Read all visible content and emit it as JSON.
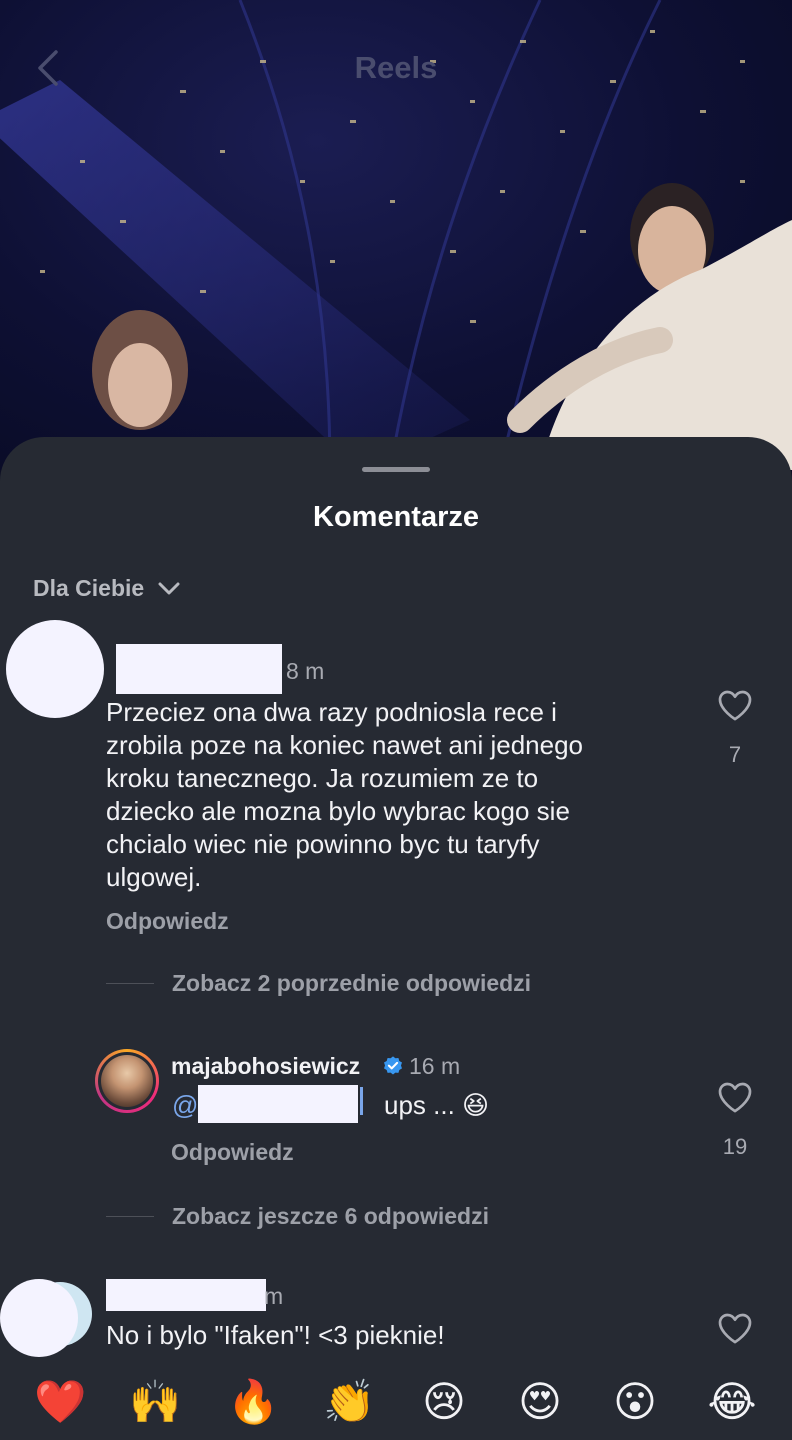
{
  "header": {
    "title": "Reels"
  },
  "sheet": {
    "title": "Komentarze",
    "sort_label": "Dla Ciebie"
  },
  "comments": [
    {
      "time": "8 m",
      "text_lines": [
        "Przeciez ona dwa razy podniosla rece i",
        "zrobila poze na koniec nawet ani jednego",
        "kroku tanecznego. Ja rozumiem ze to",
        "dziecko ale mozna bylo wybrac kogo sie",
        "chcialo wiec nie powinno byc tu taryfy",
        "ulgowej."
      ],
      "reply_label": "Odpowiedz",
      "likes": "7",
      "view_previous": "Zobacz 2 poprzednie odpowiedzi"
    },
    {
      "username": "majabohosiewicz",
      "time": "16 m",
      "mention_prefix": "@",
      "text": "ups ... 😆",
      "reply_label": "Odpowiedz",
      "likes": "19",
      "view_more": "Zobacz jeszcze 6 odpowiedzi"
    },
    {
      "time": "m",
      "text": "No i bylo \"Ifaken\"! <3 pieknie!"
    }
  ],
  "reactions": [
    "❤️",
    "🙌",
    "🔥",
    "👏",
    "😢",
    "😍",
    "😮",
    "😂"
  ],
  "colors": {
    "sheet": "#262a33",
    "verified": "#3897f0",
    "redaction": "#f4f3ff"
  }
}
